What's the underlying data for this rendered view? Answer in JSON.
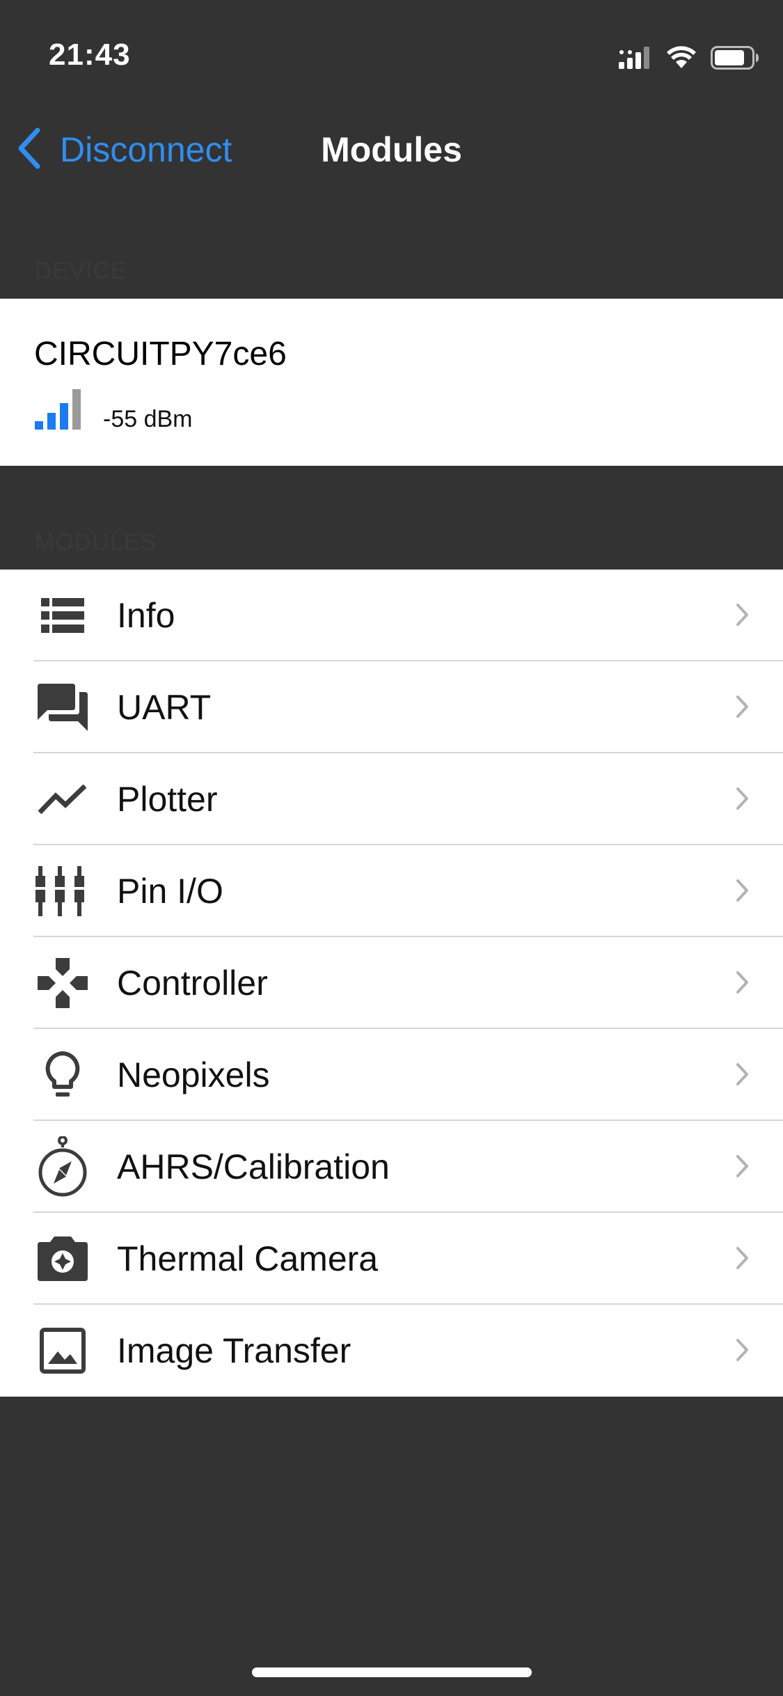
{
  "status_bar": {
    "time": "21:43"
  },
  "nav": {
    "back_label": "Disconnect",
    "title": "Modules"
  },
  "sections": {
    "device_header": "DEVICE",
    "modules_header": "MODULES"
  },
  "device": {
    "name": "CIRCUITPY7ce6",
    "rssi": "-55 dBm",
    "signal_bars_active": 3,
    "signal_bars_total": 4,
    "signal_color": "#1a7cf0"
  },
  "modules": [
    {
      "label": "Info",
      "icon": "list-icon"
    },
    {
      "label": "UART",
      "icon": "chat-icon"
    },
    {
      "label": "Plotter",
      "icon": "line-chart-icon"
    },
    {
      "label": "Pin I/O",
      "icon": "pins-icon"
    },
    {
      "label": "Controller",
      "icon": "gamepad-icon"
    },
    {
      "label": "Neopixels",
      "icon": "lightbulb-icon"
    },
    {
      "label": "AHRS/Calibration",
      "icon": "compass-icon"
    },
    {
      "label": "Thermal Camera",
      "icon": "camera-icon"
    },
    {
      "label": "Image Transfer",
      "icon": "image-icon"
    }
  ],
  "colors": {
    "background": "#333333",
    "accent": "#2f8ef0",
    "cell": "#ffffff",
    "icon": "#3c3c3c",
    "separator": "#d6d6d6"
  }
}
